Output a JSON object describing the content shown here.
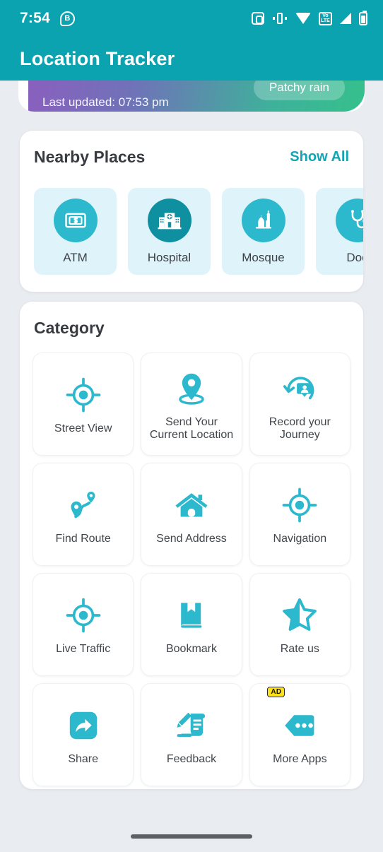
{
  "status_bar": {
    "time": "7:54",
    "badge_letter": "B",
    "icons": [
      "nfc-icon",
      "vibrate-icon",
      "wifi-icon",
      "volte-icon",
      "signal-icon",
      "battery-icon"
    ],
    "volte_top": "Vo",
    "volte_bottom": "LTE"
  },
  "app_bar": {
    "title": "Location Tracker"
  },
  "weather_card": {
    "last_updated": "Last updated: 07:53 pm",
    "condition_chip": "Patchy rain",
    "gradient_start": "#8a5fbe",
    "gradient_end": "#35c08c"
  },
  "nearby_places": {
    "title": "Nearby Places",
    "show_all": "Show All",
    "items": [
      {
        "label": "ATM",
        "icon": "atm-icon",
        "tone": "light"
      },
      {
        "label": "Hospital",
        "icon": "hospital-icon",
        "tone": "dark"
      },
      {
        "label": "Mosque",
        "icon": "mosque-icon",
        "tone": "light"
      },
      {
        "label": "Doc",
        "icon": "doctor-icon",
        "tone": "light"
      }
    ]
  },
  "category": {
    "title": "Category",
    "items": [
      {
        "label": "Street View",
        "icon": "crosshair-icon"
      },
      {
        "label": "Send Your Current Location",
        "icon": "map-pin-icon"
      },
      {
        "label": "Record your Journey",
        "icon": "record-journey-icon"
      },
      {
        "label": "Find Route",
        "icon": "route-icon"
      },
      {
        "label": "Send Address",
        "icon": "home-icon"
      },
      {
        "label": "Navigation",
        "icon": "crosshair-icon"
      },
      {
        "label": "Live Traffic",
        "icon": "crosshair-icon"
      },
      {
        "label": "Bookmark",
        "icon": "bookmark-book-icon"
      },
      {
        "label": "Rate us",
        "icon": "star-half-icon"
      },
      {
        "label": "Share",
        "icon": "share-icon"
      },
      {
        "label": "Feedback",
        "icon": "feedback-icon"
      },
      {
        "label": "More Apps",
        "icon": "more-apps-icon",
        "badge": "AD"
      }
    ]
  },
  "theme": {
    "primary": "#0ca3b1",
    "accent": "#2cb9ce",
    "background": "#e9ecf0",
    "card": "#ffffff",
    "chip_background": "#dff4fa",
    "ad_badge": "#ffe11a"
  },
  "nav_bar": {
    "gesture_pill": "home-gesture-pill"
  }
}
